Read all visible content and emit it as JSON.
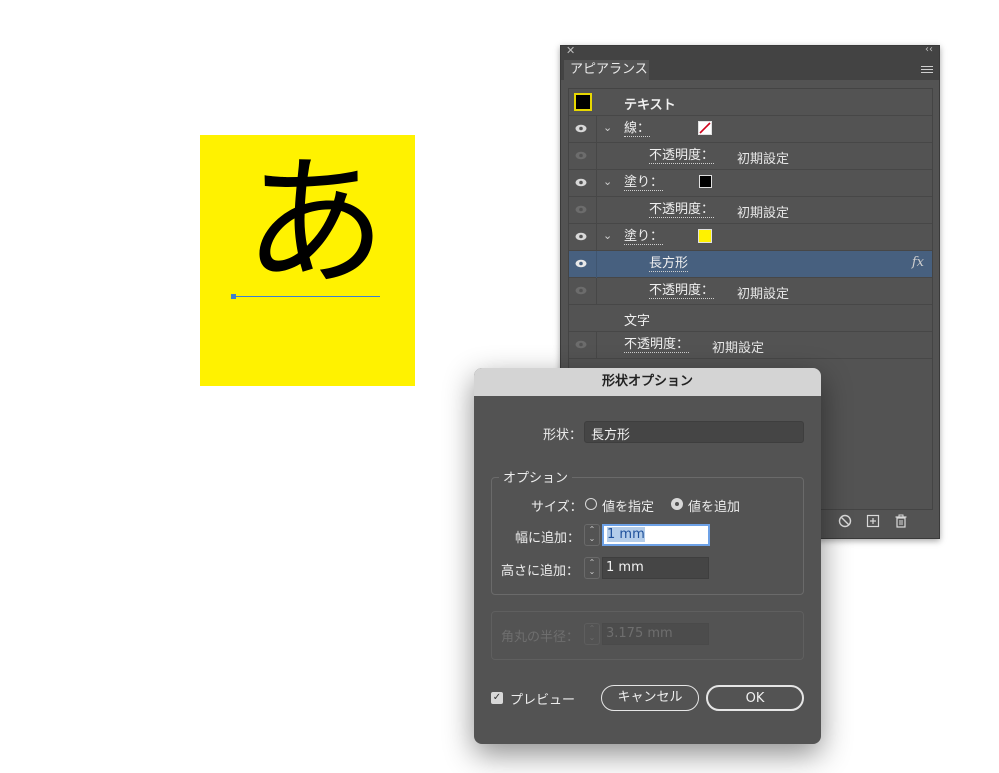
{
  "artwork": {
    "glyph": "あ",
    "background": "#fff200"
  },
  "panel": {
    "tab": "アピアランス",
    "rows": [
      {
        "label": "テキスト"
      },
      {
        "label": "線："
      },
      {
        "label": "不透明度：",
        "value": "初期設定"
      },
      {
        "label": "塗り："
      },
      {
        "label": "不透明度：",
        "value": "初期設定"
      },
      {
        "label": "塗り："
      },
      {
        "label": "長方形",
        "fx": "fx"
      },
      {
        "label": "不透明度：",
        "value": "初期設定"
      },
      {
        "label": "文字"
      },
      {
        "label": "不透明度：",
        "value": "初期設定"
      }
    ],
    "colors": {
      "fill_black": "#000000",
      "fill_yellow": "#fff200",
      "selection": "#47607f"
    }
  },
  "dialog": {
    "title": "形状オプション",
    "shape_label": "形状：",
    "shape_value": "長方形",
    "options_legend": "オプション",
    "size_label": "サイズ：",
    "radio_specify": "値を指定",
    "radio_add": "値を追加",
    "width_label": "幅に追加：",
    "width_value": "1 mm",
    "height_label": "高さに追加：",
    "height_value": "1 mm",
    "corner_label": "角丸の半径：",
    "corner_value": "3.175 mm",
    "preview_label": "プレビュー",
    "cancel_label": "キャンセル",
    "ok_label": "OK"
  }
}
